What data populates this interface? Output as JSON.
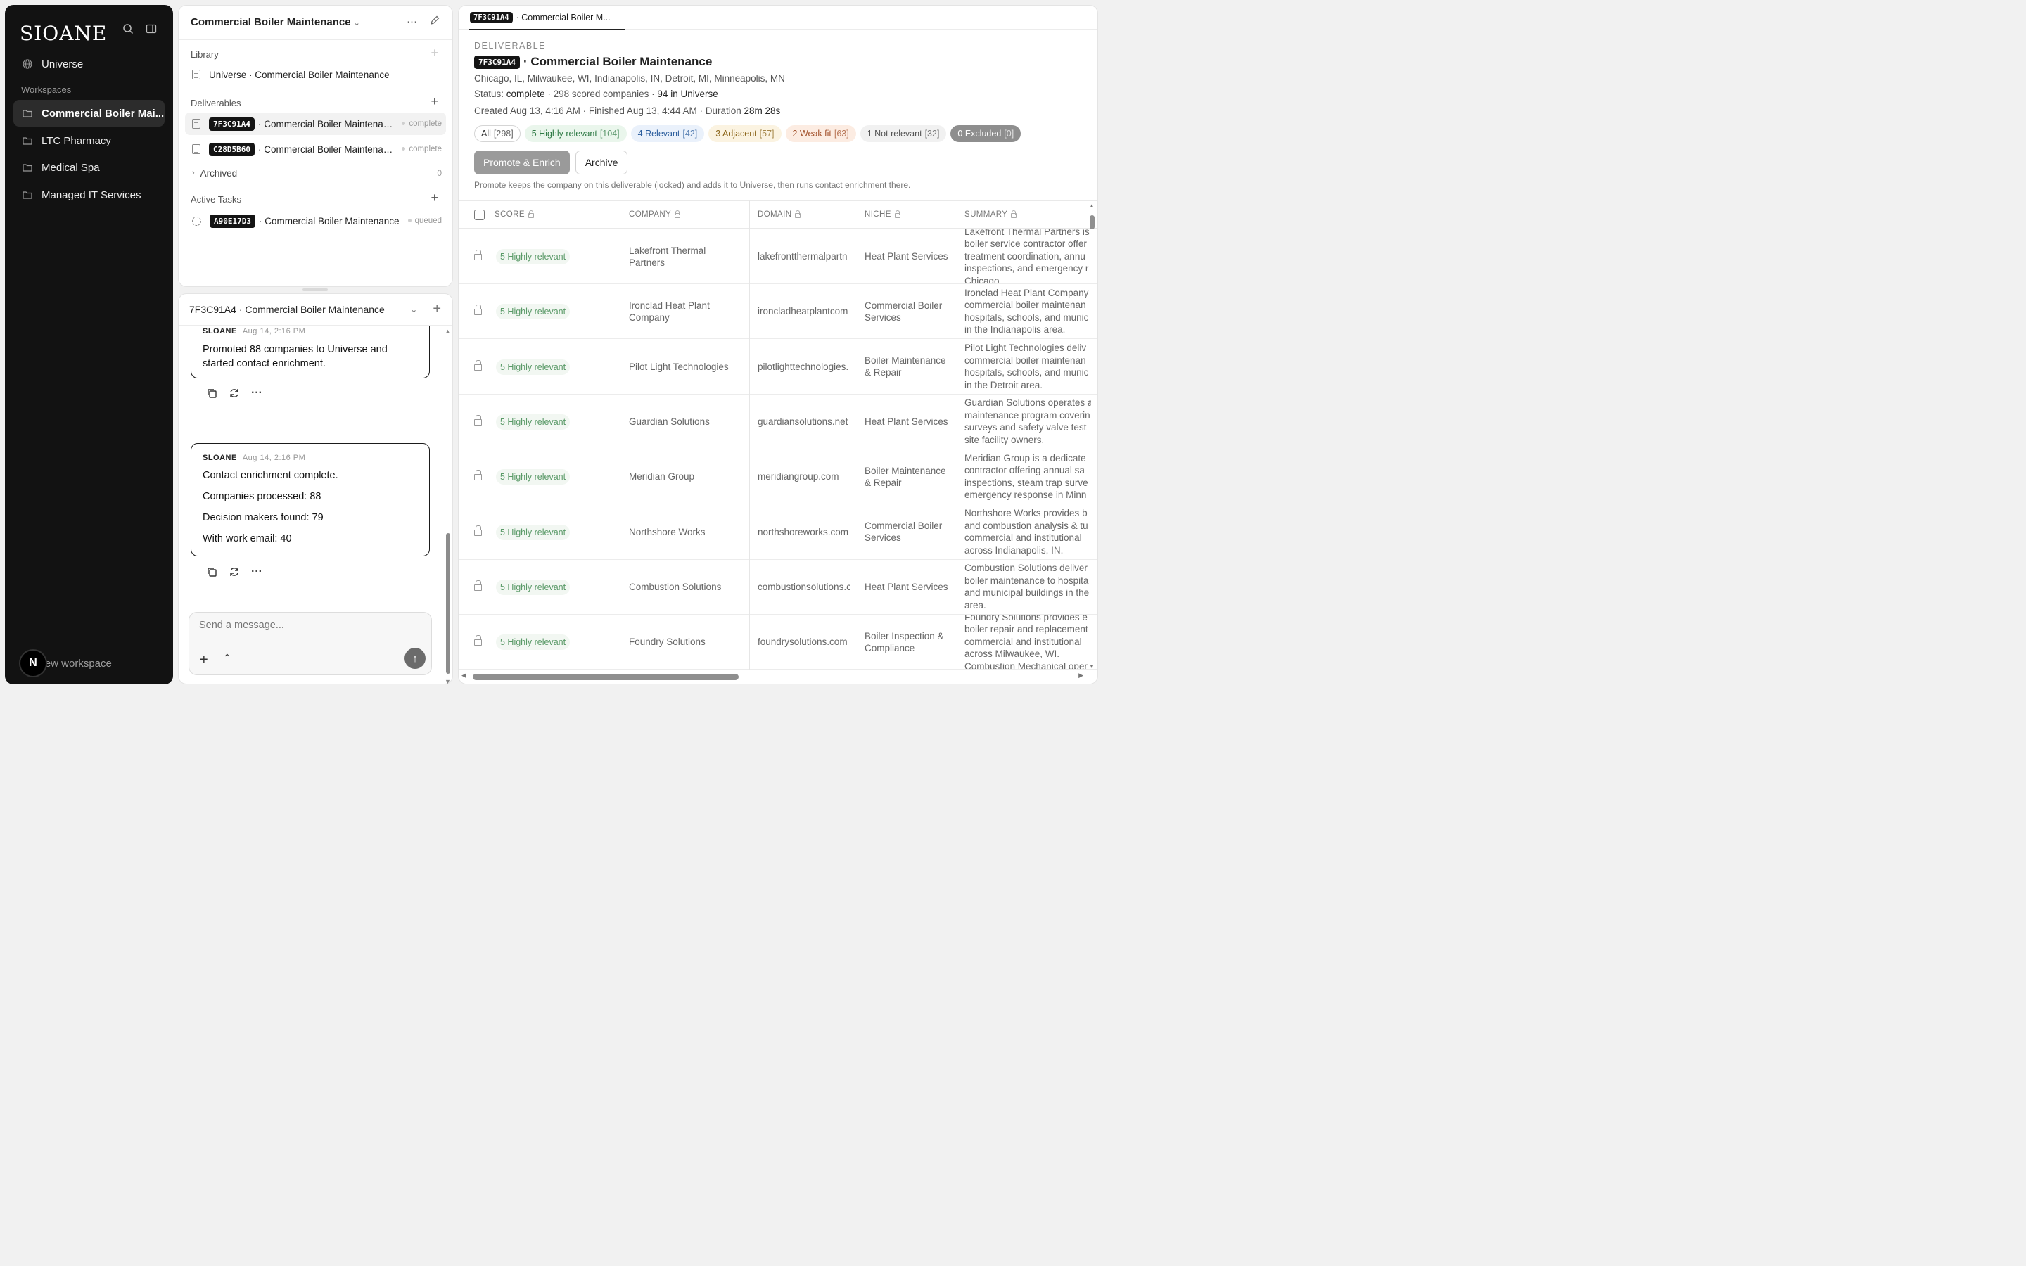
{
  "sidebar": {
    "logo": "SIOANE",
    "universe": "Universe",
    "workspaces_label": "Workspaces",
    "workspaces": [
      "Commercial Boiler Mai...",
      "LTC Pharmacy",
      "Medical Spa",
      "Managed IT Services"
    ],
    "avatar_letter": "N",
    "new_workspace": "New workspace"
  },
  "workspace_panel": {
    "title": "Commercial Boiler Maintenance",
    "library_label": "Library",
    "library_item": "Universe · Commercial Boiler Maintenance",
    "deliverables_label": "Deliverables",
    "deliverables": [
      {
        "id": "7F3C91A4",
        "name": "· Commercial Boiler Maintenance",
        "status": "complete"
      },
      {
        "id": "C28D5B60",
        "name": "· Commercial Boiler Maintenance",
        "status": "complete"
      }
    ],
    "archived_label": "Archived",
    "archived_count": "0",
    "active_tasks_label": "Active Tasks",
    "tasks": [
      {
        "id": "A90E17D3",
        "name": "· Commercial Boiler Maintenance",
        "status": "queued"
      }
    ]
  },
  "chat": {
    "header": "7F3C91A4 · Commercial Boiler Maintenance",
    "messages": [
      {
        "sender": "SLOANE",
        "time": "Aug 14, 2:16 PM",
        "lines": [
          "Promoted 88 companies to Universe and started contact enrichment."
        ]
      },
      {
        "sender": "SLOANE",
        "time": "Aug 14, 2:16 PM",
        "lines": [
          "Contact enrichment complete.",
          "Companies processed: 88",
          "Decision makers found: 79",
          "With work email: 40"
        ]
      }
    ],
    "placeholder": "Send a message..."
  },
  "deliverable": {
    "tab_id": "7F3C91A4",
    "tab_title": "· Commercial Boiler M...",
    "section_label": "DELIVERABLE",
    "id": "7F3C91A4",
    "title": "· Commercial Boiler Maintenance",
    "locations": "Chicago, IL, Milwaukee, WI, Indianapolis, IN, Detroit, MI, Minneapolis, MN",
    "status_prefix": "Status:",
    "status_value": "complete",
    "status_rest": "· 298 scored companies · ",
    "in_universe": "94 in Universe",
    "created_text": "Created Aug 13, 4:16 AM · Finished Aug 13, 4:44 AM · Duration ",
    "duration": "28m 28s",
    "filters": [
      {
        "label": "All",
        "count": "[298]",
        "bg": "#ffffff",
        "fg": "#333333",
        "border": "#d5d5d5"
      },
      {
        "label": "5 Highly relevant",
        "count": "[104]",
        "bg": "#eaf6ec",
        "fg": "#2f7a45",
        "border": "#eaf6ec"
      },
      {
        "label": "4 Relevant",
        "count": "[42]",
        "bg": "#eaf1fb",
        "fg": "#2d5f9e",
        "border": "#eaf1fb"
      },
      {
        "label": "3 Adjacent",
        "count": "[57]",
        "bg": "#fbf3e1",
        "fg": "#8a6418",
        "border": "#fbf3e1"
      },
      {
        "label": "2 Weak fit",
        "count": "[63]",
        "bg": "#fcece2",
        "fg": "#a2502a",
        "border": "#fcece2"
      },
      {
        "label": "1 Not relevant",
        "count": "[32]",
        "bg": "#f1f1f1",
        "fg": "#555555",
        "border": "#f1f1f1"
      },
      {
        "label": "0 Excluded",
        "count": "[0]",
        "bg": "#8e8e8e",
        "fg": "#ffffff",
        "border": "#8e8e8e"
      }
    ],
    "promote_label": "Promote & Enrich",
    "archive_label": "Archive",
    "note": "Promote keeps the company on this deliverable (locked) and adds it to Universe, then runs contact enrichment there.",
    "columns": [
      "SCORE",
      "COMPANY",
      "DOMAIN",
      "NICHE",
      "SUMMARY"
    ],
    "rows": [
      {
        "score": "5 Highly relevant",
        "company": "Lakefront Thermal Partners",
        "domain": "lakefrontthermalpartn",
        "niche": "Heat Plant Services",
        "summary": [
          "Lakefront Thermal Partners is",
          "boiler service contractor offer",
          "treatment coordination, annu",
          "inspections, and emergency r",
          "Chicago."
        ]
      },
      {
        "score": "5 Highly relevant",
        "company": "Ironclad Heat Plant Company",
        "domain": "ironcladheatplantcom",
        "niche": "Commercial Boiler Services",
        "summary": [
          "Ironclad Heat Plant Company",
          "commercial boiler maintenan",
          "hospitals, schools, and munic",
          "in the Indianapolis area."
        ]
      },
      {
        "score": "5 Highly relevant",
        "company": "Pilot Light Technologies",
        "domain": "pilotlighttechnologies.",
        "niche": "Boiler Maintenance & Repair",
        "summary": [
          "Pilot Light Technologies deliv",
          "commercial boiler maintenan",
          "hospitals, schools, and munic",
          "in the Detroit area."
        ]
      },
      {
        "score": "5 Highly relevant",
        "company": "Guardian Solutions",
        "domain": "guardiansolutions.net",
        "niche": "Heat Plant Services",
        "summary": [
          "Guardian Solutions operates a",
          "maintenance program coverin",
          "surveys and safety valve test",
          "site facility owners."
        ]
      },
      {
        "score": "5 Highly relevant",
        "company": "Meridian Group",
        "domain": "meridiangroup.com",
        "niche": "Boiler Maintenance & Repair",
        "summary": [
          "Meridian Group is a dedicate",
          "contractor offering annual sa",
          "inspections, steam trap surve",
          "emergency response in Minn"
        ]
      },
      {
        "score": "5 Highly relevant",
        "company": "Northshore Works",
        "domain": "northshoreworks.com",
        "niche": "Commercial Boiler Services",
        "summary": [
          "Northshore Works provides b",
          "and combustion analysis & tu",
          "commercial and institutional",
          "across Indianapolis, IN."
        ]
      },
      {
        "score": "5 Highly relevant",
        "company": "Combustion Solutions",
        "domain": "combustionsolutions.c",
        "niche": "Heat Plant Services",
        "summary": [
          "Combustion Solutions deliver",
          "boiler maintenance to hospita",
          "and municipal buildings in the",
          "area."
        ]
      },
      {
        "score": "5 Highly relevant",
        "company": "Foundry Solutions",
        "domain": "foundrysolutions.com",
        "niche": "Boiler Inspection & Compliance",
        "summary": [
          "Foundry Solutions provides e",
          "boiler repair and replacement",
          "commercial and institutional",
          "across Milwaukee, WI.",
          "Combustion Mechanical oper"
        ]
      }
    ]
  }
}
